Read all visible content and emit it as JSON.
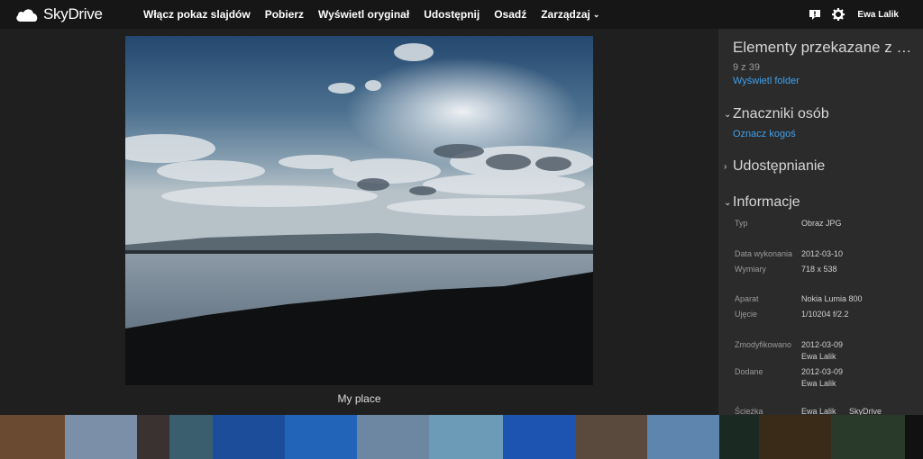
{
  "app": {
    "name": "SkyDrive"
  },
  "nav": [
    {
      "label": "Włącz pokaz slajdów"
    },
    {
      "label": "Pobierz"
    },
    {
      "label": "Wyświetl oryginał"
    },
    {
      "label": "Udostępnij"
    },
    {
      "label": "Osadź"
    },
    {
      "label": "Zarządzaj"
    }
  ],
  "user": {
    "name": "Ewa Lalik"
  },
  "photo": {
    "caption": "My place"
  },
  "panel": {
    "title": "Elementy przekazane z u...",
    "count": "9 z 39",
    "view_folder": "Wyświetl folder",
    "sections": {
      "tags": "Znaczniki osób",
      "tag_someone": "Oznacz kogoś",
      "sharing": "Udostępnianie",
      "info": "Informacje"
    },
    "info": [
      {
        "label": "Typ",
        "value": "Obraz JPG"
      },
      {
        "label": "Data wykonania",
        "value": "2012-03-10"
      },
      {
        "label": "Wymiary",
        "value": "718 x 538"
      },
      {
        "label": "Aparat",
        "value": "Nokia Lumia 800"
      },
      {
        "label": "Ujęcie",
        "value": "1/10204 f/2.2"
      },
      {
        "label": "Zmodyfikowano",
        "value": "2012-03-09"
      },
      {
        "label": "",
        "value": "Ewa Lalik"
      },
      {
        "label": "Dodane",
        "value": "2012-03-09"
      },
      {
        "label": "",
        "value": "Ewa Lalik"
      },
      {
        "label": "Ścieżka",
        "value": "Ewa Lalik"
      }
    ],
    "path_link": "SkyDrive"
  },
  "filmstrip": {
    "colors": [
      "#6b4a32",
      "#7b90a8",
      "#3a3230",
      "#3a5e6e",
      "#1c4d9b",
      "#2265b8",
      "#6d86a2",
      "#6c9bb7",
      "#1d54b2",
      "#5a4a3d",
      "#5d85ad",
      "#1a2a22",
      "#3a2a18",
      "#2a3a2a"
    ]
  }
}
